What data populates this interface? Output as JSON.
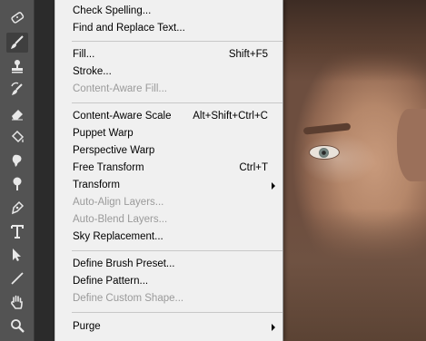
{
  "toolbar": {
    "tools": [
      {
        "name": "patch-tool-icon"
      },
      {
        "name": "brush-tool-icon",
        "active": true
      },
      {
        "name": "clone-stamp-tool-icon"
      },
      {
        "name": "history-brush-tool-icon"
      },
      {
        "name": "eraser-tool-icon"
      },
      {
        "name": "paint-bucket-tool-icon"
      },
      {
        "name": "smudge-tool-icon"
      },
      {
        "name": "dodge-tool-icon"
      },
      {
        "name": "pen-tool-icon"
      },
      {
        "name": "type-tool-icon"
      },
      {
        "name": "path-selection-tool-icon"
      },
      {
        "name": "line-tool-icon"
      },
      {
        "name": "hand-tool-icon"
      },
      {
        "name": "zoom-tool-icon"
      }
    ]
  },
  "menu": {
    "check_spelling": "Check Spelling...",
    "find_replace": "Find and Replace Text...",
    "fill": "Fill...",
    "fill_shortcut": "Shift+F5",
    "stroke": "Stroke...",
    "content_aware_fill": "Content-Aware Fill...",
    "content_aware_scale": "Content-Aware Scale",
    "content_aware_scale_shortcut": "Alt+Shift+Ctrl+C",
    "puppet_warp": "Puppet Warp",
    "perspective_warp": "Perspective Warp",
    "free_transform": "Free Transform",
    "free_transform_shortcut": "Ctrl+T",
    "transform": "Transform",
    "auto_align": "Auto-Align Layers...",
    "auto_blend": "Auto-Blend Layers...",
    "sky_replacement": "Sky Replacement...",
    "define_brush": "Define Brush Preset...",
    "define_pattern": "Define Pattern...",
    "define_shape": "Define Custom Shape...",
    "purge": "Purge"
  },
  "colors": {
    "menu_bg": "#f0f0f0",
    "toolbar_bg": "#535353",
    "disabled_text": "#9a9a9a"
  }
}
